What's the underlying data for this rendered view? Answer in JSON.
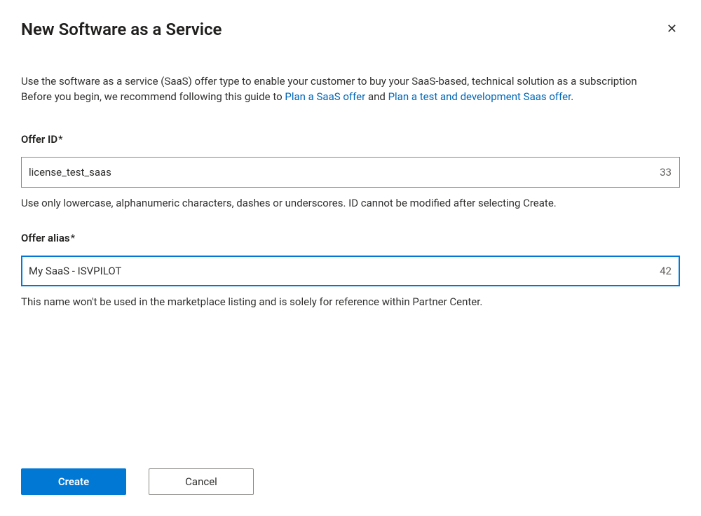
{
  "dialog": {
    "title": "New Software as a Service"
  },
  "intro": {
    "line1": "Use the software as a service (SaaS) offer type to enable your customer to buy your SaaS-based, technical solution as a subscription",
    "line2_prefix": "Before you begin, we recommend following this guide to ",
    "link1": "Plan a SaaS offer",
    "middle": " and ",
    "link2": "Plan a test and development Saas offer",
    "period": "."
  },
  "fields": {
    "offer_id": {
      "label": "Offer ID",
      "required_marker": "*",
      "value": "license_test_saas",
      "char_count": "33",
      "help": "Use only lowercase, alphanumeric characters, dashes or underscores. ID cannot be modified after selecting Create."
    },
    "offer_alias": {
      "label": "Offer alias",
      "required_marker": "*",
      "value": "My SaaS - ISVPILOT",
      "char_count": "42",
      "help": "This name won't be used in the marketplace listing and is solely for reference within Partner Center."
    }
  },
  "buttons": {
    "create": "Create",
    "cancel": "Cancel"
  }
}
